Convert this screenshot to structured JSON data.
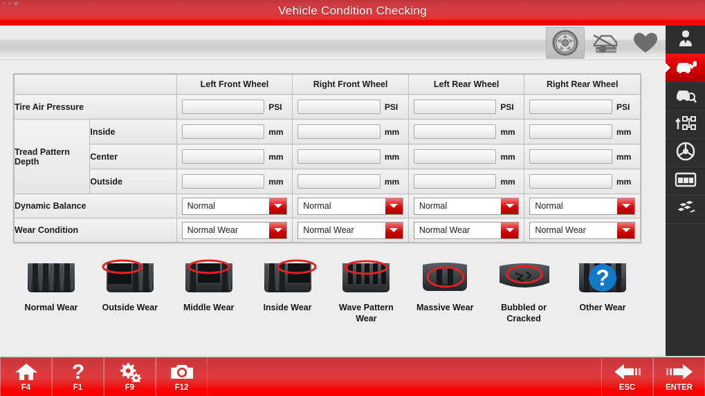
{
  "window": {
    "title": "Vehicle Condition Checking",
    "system_marks": "···"
  },
  "toolbar": {
    "buttons": [
      {
        "name": "wheel-icon",
        "label": "Wheel",
        "active": true
      },
      {
        "name": "car-lift-icon",
        "label": "Vehicle Lift",
        "active": false
      },
      {
        "name": "heart-icon",
        "label": "Favorites",
        "active": false
      }
    ]
  },
  "table": {
    "corner_header": "",
    "columns": [
      "Left Front Wheel",
      "Right Front Wheel",
      "Left Rear Wheel",
      "Right Rear Wheel"
    ],
    "rows": [
      {
        "label": "Tire Air Pressure",
        "sublabel": "",
        "type": "input",
        "unit": "PSI",
        "values": [
          "",
          "",
          "",
          ""
        ]
      },
      {
        "label": "Tread Pattern Depth",
        "sublabel": "Inside",
        "type": "input",
        "unit": "mm",
        "values": [
          "",
          "",
          "",
          ""
        ]
      },
      {
        "label": "",
        "sublabel": "Center",
        "type": "input",
        "unit": "mm",
        "values": [
          "",
          "",
          "",
          ""
        ]
      },
      {
        "label": "",
        "sublabel": "Outside",
        "type": "input",
        "unit": "mm",
        "values": [
          "",
          "",
          "",
          ""
        ]
      },
      {
        "label": "Dynamic Balance",
        "sublabel": "",
        "type": "select",
        "unit": "",
        "values": [
          "Normal",
          "Normal",
          "Normal",
          "Normal"
        ]
      },
      {
        "label": "Wear Condition",
        "sublabel": "",
        "type": "select",
        "unit": "",
        "values": [
          "Normal Wear",
          "Normal Wear",
          "Normal Wear",
          "Normal Wear"
        ]
      }
    ]
  },
  "legend": {
    "items": [
      {
        "caption": "Normal Wear",
        "icon": "tire-normal-wear-icon",
        "marker": "none"
      },
      {
        "caption": "Outside Wear",
        "icon": "tire-outside-wear-icon",
        "marker": "ellipse-left"
      },
      {
        "caption": "Middle Wear",
        "icon": "tire-middle-wear-icon",
        "marker": "ellipse-top"
      },
      {
        "caption": "Inside Wear",
        "icon": "tire-inside-wear-icon",
        "marker": "ellipse-right"
      },
      {
        "caption": "Wave Pattern Wear",
        "icon": "tire-wave-pattern-icon",
        "marker": "ellipse-top"
      },
      {
        "caption": "Massive Wear",
        "icon": "tire-massive-wear-icon",
        "marker": "ellipse-center"
      },
      {
        "caption": "Bubbled or Cracked",
        "icon": "tire-bubbled-cracked-icon",
        "marker": "ellipse-center"
      },
      {
        "caption": "Other Wear",
        "icon": "tire-other-wear-icon",
        "marker": "question"
      }
    ]
  },
  "sidebar": {
    "items": [
      {
        "name": "sidebar-item-technician",
        "icon": "technician-icon",
        "selected": false
      },
      {
        "name": "sidebar-item-repair",
        "icon": "car-wrench-icon",
        "selected": true
      },
      {
        "name": "sidebar-item-inspection",
        "icon": "car-magnifier-icon",
        "selected": false
      },
      {
        "name": "sidebar-item-alignment",
        "icon": "wheel-alignment-icon",
        "selected": false
      },
      {
        "name": "sidebar-item-steering",
        "icon": "steering-wheel-icon",
        "selected": false
      },
      {
        "name": "sidebar-item-dashboard",
        "icon": "dashboard-icon",
        "selected": false
      },
      {
        "name": "sidebar-item-reports",
        "icon": "tiles-icon",
        "selected": false
      }
    ]
  },
  "bottombar": {
    "keys": [
      {
        "label": "F4",
        "icon": "home-icon",
        "name": "home-key"
      },
      {
        "label": "F1",
        "icon": "help-icon",
        "name": "help-key"
      },
      {
        "label": "F9",
        "icon": "settings-icon",
        "name": "settings-key"
      },
      {
        "label": "F12",
        "icon": "camera-icon",
        "name": "camera-key"
      },
      {
        "label": "ESC",
        "icon": "back-arrow-icon",
        "name": "esc-key"
      },
      {
        "label": "ENTER",
        "icon": "forward-arrow-icon",
        "name": "enter-key"
      }
    ]
  },
  "colors": {
    "brand_red": "#fb0000",
    "title_red_dark": "#c2353c",
    "sidebar_dark": "#2e2e2e",
    "selected_red": "#d60000",
    "marker_red": "#e22222",
    "question_blue": "#1279c6",
    "content_bg": "#ededed"
  }
}
